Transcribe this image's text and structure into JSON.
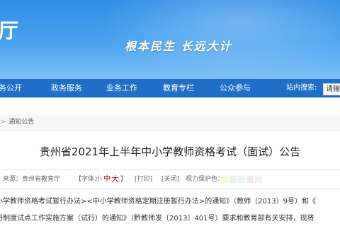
{
  "header": {
    "brand_fragment": "厅",
    "slogan": "根本民生 长远大计",
    "colors": {
      "banner": "#3b97ea",
      "nav": "#1f6fc8"
    }
  },
  "nav": {
    "items": [
      "务公开",
      "政务服务",
      "业务工作",
      "教育专栏",
      "公众参与"
    ],
    "search_label": "站内搜索:",
    "search_value": "请输"
  },
  "breadcrumb": {
    "sep": ">",
    "current": "通知公告"
  },
  "article": {
    "title": "贵州省2021年上半年中小学教师资格考试（面试）公告",
    "meta": {
      "source": "来源：贵州省教育厅",
      "font_prefix": "【字体：",
      "font_small": "小",
      "font_medium": "中",
      "font_large": "大",
      "font_suffix": "】",
      "print": "[打印]",
      "close": "[关闭]",
      "eye_care": "视力保护色：",
      "eye_colors": [
        "#fafac8",
        "#e6f5e6",
        "#eaf2fc",
        "#f5e8f5",
        "#f2f2f2"
      ]
    },
    "line1": "小学教师资格考试暂行办法><中小学教师资格定期注册暂行办法>的通知》（教师〔2013〕9号）和《",
    "line2": "册制度试点工作实施方案（试行）的通知》（黔教师发〔2013〕401号）要求和教育部有关安排，现将"
  }
}
